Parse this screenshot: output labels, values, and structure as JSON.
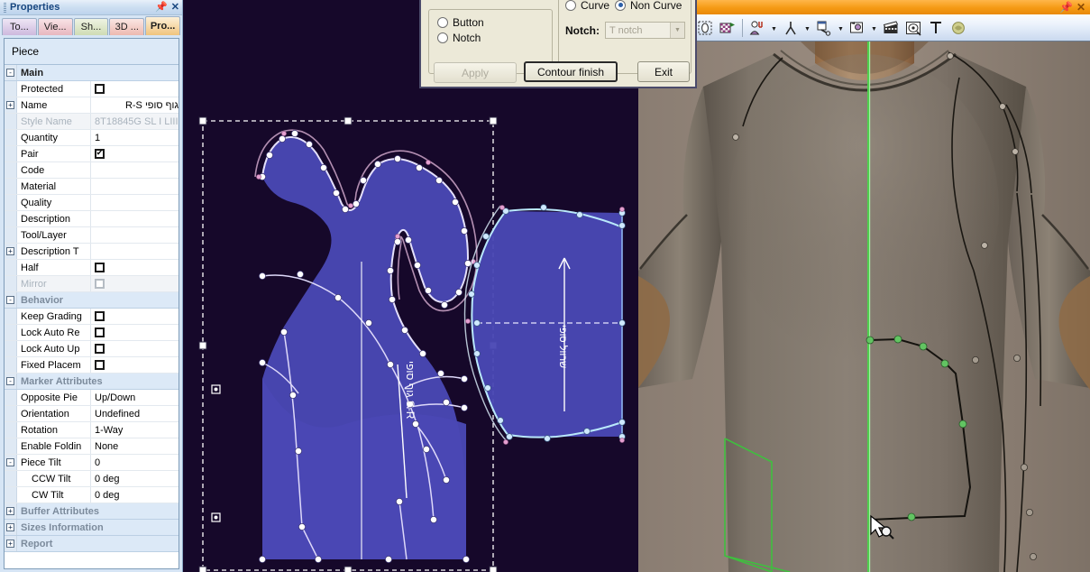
{
  "properties_panel": {
    "title": "Properties",
    "pin_icon": "pin-icon",
    "close_icon": "close-icon",
    "tabs": [
      {
        "label": "To...",
        "name": "tools"
      },
      {
        "label": "Vie...",
        "name": "view"
      },
      {
        "label": "Sh...",
        "name": "shape"
      },
      {
        "label": "3D ...",
        "name": "3d"
      },
      {
        "label": "Pro...",
        "name": "properties"
      }
    ],
    "active_tab_index": 4,
    "header": "Piece",
    "rows": [
      {
        "kind": "section",
        "expander": "-",
        "label": "Main",
        "value": "",
        "active": true
      },
      {
        "kind": "check",
        "expander": "",
        "label": "Protected",
        "value": "",
        "checked": false
      },
      {
        "kind": "text",
        "expander": "+",
        "label": "Name",
        "value": "גוף סופי S-R",
        "rtl": true
      },
      {
        "kind": "text",
        "expander": "",
        "label": "Style Name",
        "value": "8T18845G  SL I LIII",
        "disabled": true
      },
      {
        "kind": "text",
        "expander": "",
        "label": "Quantity",
        "value": "1"
      },
      {
        "kind": "check",
        "expander": "",
        "label": "Pair",
        "value": "",
        "checked": true
      },
      {
        "kind": "text",
        "expander": "",
        "label": "Code",
        "value": ""
      },
      {
        "kind": "text",
        "expander": "",
        "label": "Material",
        "value": ""
      },
      {
        "kind": "text",
        "expander": "",
        "label": "Quality",
        "value": ""
      },
      {
        "kind": "text",
        "expander": "",
        "label": "Description",
        "value": ""
      },
      {
        "kind": "text",
        "expander": "",
        "label": "Tool/Layer",
        "value": ""
      },
      {
        "kind": "text",
        "expander": "+",
        "label": "Description T",
        "value": ""
      },
      {
        "kind": "check",
        "expander": "",
        "label": "Half",
        "value": "",
        "checked": false
      },
      {
        "kind": "check",
        "expander": "",
        "label": "Mirror",
        "value": "",
        "checked": false,
        "disabled": true
      },
      {
        "kind": "section",
        "expander": "-",
        "label": "Behavior",
        "value": ""
      },
      {
        "kind": "check",
        "expander": "",
        "label": "Keep Grading",
        "value": "",
        "checked": false
      },
      {
        "kind": "check",
        "expander": "",
        "label": "Lock Auto Re",
        "value": "",
        "checked": false
      },
      {
        "kind": "check",
        "expander": "",
        "label": "Lock Auto Up",
        "value": "",
        "checked": false
      },
      {
        "kind": "check",
        "expander": "",
        "label": "Fixed Placem",
        "value": "",
        "checked": false
      },
      {
        "kind": "section",
        "expander": "-",
        "label": "Marker Attributes",
        "value": ""
      },
      {
        "kind": "text",
        "expander": "",
        "label": "Opposite Pie",
        "value": "Up/Down"
      },
      {
        "kind": "text",
        "expander": "",
        "label": "Orientation",
        "value": "Undefined"
      },
      {
        "kind": "text",
        "expander": "",
        "label": "Rotation",
        "value": "1-Way"
      },
      {
        "kind": "text",
        "expander": "",
        "label": "Enable Foldin",
        "value": "None"
      },
      {
        "kind": "text",
        "expander": "-",
        "label": "Piece Tilt",
        "value": "0"
      },
      {
        "kind": "text",
        "expander": "",
        "label": "CCW Tilt",
        "value": "0 deg",
        "indent": true
      },
      {
        "kind": "text",
        "expander": "",
        "label": "CW Tilt",
        "value": "0 deg",
        "indent": true
      },
      {
        "kind": "section",
        "expander": "+",
        "label": "Buffer Attributes",
        "value": ""
      },
      {
        "kind": "section",
        "expander": "+",
        "label": "Sizes Information",
        "value": ""
      },
      {
        "kind": "section",
        "expander": "+",
        "label": "Report",
        "value": ""
      }
    ]
  },
  "dialog": {
    "left_group": {
      "options": [
        {
          "label": "Button",
          "selected": false
        },
        {
          "label": "Notch",
          "selected": false
        }
      ]
    },
    "right_group": {
      "options": [
        {
          "label": "Curve",
          "selected": false
        },
        {
          "label": "Non Curve",
          "selected": true
        }
      ],
      "notch_label": "Notch:",
      "notch_value": "T notch",
      "notch_dropdown_icon": "chevron-down-icon"
    },
    "buttons": [
      {
        "label": "Apply",
        "name": "apply-button",
        "disabled": true,
        "default": false
      },
      {
        "label": "Contour finish",
        "name": "contour-finish-button",
        "disabled": false,
        "default": true
      },
      {
        "label": "Exit",
        "name": "exit-button",
        "disabled": false,
        "default": false
      }
    ]
  },
  "canvas2d": {
    "piece_label": "גוף סופי S-R",
    "sleeve_label": "שרוול סופי",
    "piece_fill": "#4a48b4",
    "background": "#16082a",
    "outline_color": "#d8d4f5",
    "sleeve_outline_color": "#7fd4f5"
  },
  "view3d": {
    "title_pin_icon": "pin-icon",
    "title_close_icon": "close-icon",
    "toolbar": [
      {
        "name": "play-simulation-icon",
        "glyph": "play"
      },
      {
        "name": "cylinder-cut-icon",
        "glyph": "cyl"
      },
      {
        "name": "select-region-icon",
        "glyph": "selreg"
      },
      {
        "name": "texture-apply-icon",
        "glyph": "texture"
      },
      {
        "name": "avatar-tools-icon",
        "glyph": "avatar",
        "dropdown": true
      },
      {
        "name": "pose-icon",
        "glyph": "pose",
        "dropdown": true
      },
      {
        "name": "fabric-properties-icon",
        "glyph": "fabric",
        "dropdown": true
      },
      {
        "name": "image-edit-icon",
        "glyph": "imgedit",
        "dropdown": true
      },
      {
        "name": "animation-icon",
        "glyph": "clapper"
      },
      {
        "name": "render-preview-icon",
        "glyph": "render"
      },
      {
        "name": "text-tool-icon",
        "glyph": "text"
      },
      {
        "name": "stamp-icon",
        "glyph": "stamp"
      }
    ],
    "garment_color": "#7a7066",
    "skin_color": "#b08a62",
    "guide_color": "#4cd34c",
    "cursor_icon": "pointer-cursor"
  }
}
